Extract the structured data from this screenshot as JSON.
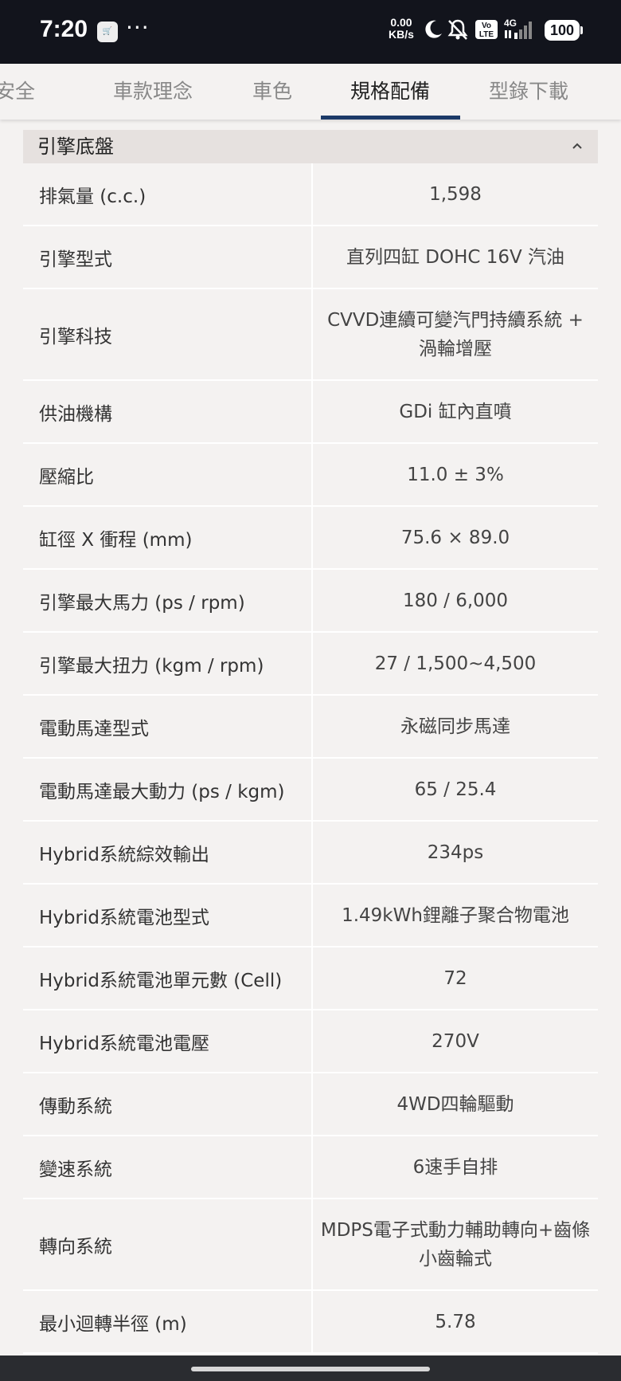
{
  "status_bar": {
    "time": "7:20",
    "app_icon": "grocery-app-icon",
    "more": "···",
    "net_speed_value": "0.00",
    "net_speed_unit": "KB/s",
    "volte": "VoLTE",
    "network": "4G",
    "battery": "100"
  },
  "tabs": [
    {
      "label": "安全"
    },
    {
      "label": "車款理念"
    },
    {
      "label": "車色"
    },
    {
      "label": "規格配備"
    },
    {
      "label": "型錄下載"
    }
  ],
  "section": {
    "title": "引擎底盤"
  },
  "specs": [
    {
      "label": "排氣量 (c.c.)",
      "value": "1,598"
    },
    {
      "label": "引擎型式",
      "value": "直列四缸 DOHC 16V 汽油"
    },
    {
      "label": "引擎科技",
      "value": "CVVD連續可變汽門持續系統 + 渦輪增壓"
    },
    {
      "label": "供油機構",
      "value": "GDi 缸內直噴"
    },
    {
      "label": "壓縮比",
      "value": "11.0 ± 3%"
    },
    {
      "label": "缸徑 X 衝程 (mm)",
      "value": "75.6 × 89.0"
    },
    {
      "label": "引擎最大馬力 (ps / rpm)",
      "value": "180 / 6,000"
    },
    {
      "label": "引擎最大扭力 (kgm / rpm)",
      "value": "27 / 1,500~4,500"
    },
    {
      "label": "電動馬達型式",
      "value": "永磁同步馬達"
    },
    {
      "label": "電動馬達最大動力 (ps / kgm)",
      "value": "65 / 25.4"
    },
    {
      "label": "Hybrid系統綜效輸出",
      "value": "234ps"
    },
    {
      "label": "Hybrid系統電池型式",
      "value": "1.49kWh鋰離子聚合物電池"
    },
    {
      "label": "Hybrid系統電池單元數 (Cell)",
      "value": "72"
    },
    {
      "label": "Hybrid系統電池電壓",
      "value": "270V"
    },
    {
      "label": "傳動系統",
      "value": "4WD四輪驅動"
    },
    {
      "label": "變速系統",
      "value": "6速手自排"
    },
    {
      "label": "轉向系統",
      "value": "MDPS電子式動力輔助轉向+齒條小齒輪式"
    },
    {
      "label": "最小迴轉半徑 (m)",
      "value": "5.78"
    }
  ],
  "colors": {
    "status_bar_bg": "#12141c",
    "accent": "#1c3a68",
    "page_bg": "#f4f2f1",
    "header_bg": "#e6e1df"
  }
}
